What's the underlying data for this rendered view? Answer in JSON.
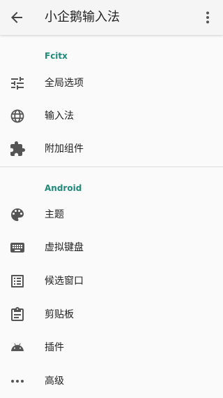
{
  "appbar": {
    "title": "小企鹅输入法"
  },
  "sections": [
    {
      "title": "Fcitx",
      "items": [
        {
          "label": "全局选项",
          "icon": "sliders-icon"
        },
        {
          "label": "输入法",
          "icon": "globe-icon"
        },
        {
          "label": "附加组件",
          "icon": "extension-icon"
        }
      ]
    },
    {
      "title": "Android",
      "items": [
        {
          "label": "主题",
          "icon": "palette-icon"
        },
        {
          "label": "虚拟键盘",
          "icon": "keyboard-icon"
        },
        {
          "label": "候选窗口",
          "icon": "list-icon"
        },
        {
          "label": "剪贴板",
          "icon": "clipboard-icon"
        },
        {
          "label": "插件",
          "icon": "android-icon"
        },
        {
          "label": "高级",
          "icon": "more-horiz-icon"
        }
      ]
    }
  ],
  "colors": {
    "accent": "#1e8a7a",
    "icon": "#555555"
  }
}
